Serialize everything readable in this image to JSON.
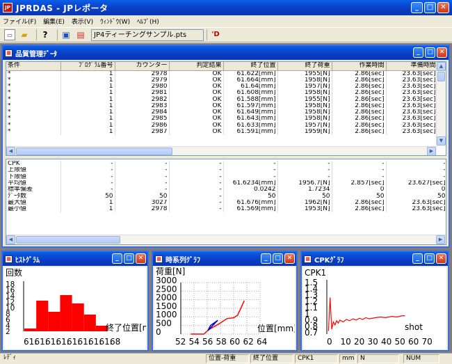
{
  "app": {
    "title": "JPRDAS - JPレポータ",
    "icon_label": "JP"
  },
  "menu": [
    "ファイル(F)",
    "編集(E)",
    "表示(V)",
    "ｳｨﾝﾄﾞｳ(W)",
    "ﾍﾙﾌﾟ(H)"
  ],
  "toolbar": {
    "file_name": "JP4ティーチングサンプル.pts"
  },
  "quality_window": {
    "title": "品質管理ﾃﾞｰﾀ",
    "columns": [
      "条件",
      "ﾌﾟﾛｸﾞﾗﾑ番号",
      "カウンター",
      "判定結果",
      "終了位置",
      "終了荷重",
      "作業時間",
      "準備時間"
    ],
    "rows": [
      [
        "*",
        "1",
        "2978",
        "OK",
        "61.622[mm]",
        "1955[N]",
        "2.86[sec]",
        "23.63[sec]"
      ],
      [
        "*",
        "1",
        "2979",
        "OK",
        "61.664[mm]",
        "1958[N]",
        "2.86[sec]",
        "23.63[sec]"
      ],
      [
        "*",
        "1",
        "2980",
        "OK",
        "61.64[mm]",
        "1957[N]",
        "2.86[sec]",
        "23.63[sec]"
      ],
      [
        "*",
        "1",
        "2981",
        "OK",
        "61.608[mm]",
        "1958[N]",
        "2.86[sec]",
        "23.63[sec]"
      ],
      [
        "*",
        "1",
        "2982",
        "OK",
        "61.588[mm]",
        "1955[N]",
        "2.86[sec]",
        "23.63[sec]"
      ],
      [
        "*",
        "1",
        "2983",
        "OK",
        "61.597[mm]",
        "1958[N]",
        "2.86[sec]",
        "23.63[sec]"
      ],
      [
        "*",
        "1",
        "2984",
        "OK",
        "61.649[mm]",
        "1958[N]",
        "2.86[sec]",
        "23.63[sec]"
      ],
      [
        "*",
        "1",
        "2985",
        "OK",
        "61.643[mm]",
        "1958[N]",
        "2.86[sec]",
        "23.63[sec]"
      ],
      [
        "*",
        "1",
        "2986",
        "OK",
        "61.633[mm]",
        "1957[N]",
        "2.86[sec]",
        "23.63[sec]"
      ],
      [
        "*",
        "1",
        "2987",
        "OK",
        "61.591[mm]",
        "1959[N]",
        "2.86[sec]",
        "23.63[sec]"
      ]
    ],
    "stats_rows": [
      [
        "CPK",
        "-",
        "-",
        "-",
        "-",
        "-",
        "-",
        "-"
      ],
      [
        "上限値",
        "-",
        "-",
        "-",
        "-",
        "-",
        "-",
        "-"
      ],
      [
        "下限値",
        "-",
        "-",
        "-",
        "-",
        "-",
        "-",
        "-"
      ],
      [
        "平均値",
        "-",
        "-",
        "-",
        "61.6234[mm]",
        "1956.7[N]",
        "2.857[sec]",
        "23.627[sec]"
      ],
      [
        "標準偏差",
        "-",
        "-",
        "-",
        "0.0242",
        "1.7234",
        "0",
        "0"
      ],
      [
        "ﾃﾞｰﾀ数",
        "50",
        "50",
        "-",
        "50",
        "50",
        "50",
        "50"
      ],
      [
        "最大値",
        "1",
        "3027",
        "-",
        "61.676[mm]",
        "1962[N]",
        "2.86[sec]",
        "23.63[sec]"
      ],
      [
        "最小値",
        "1",
        "2978",
        "-",
        "61.569[mm]",
        "1953[N]",
        "2.86[sec]",
        "23.63[sec]"
      ]
    ]
  },
  "histogram_window": {
    "title": "ﾋｽﾄｸﾞﾗﾑ"
  },
  "timeseries_window": {
    "title": "時系列ｸﾞﾗﾌ"
  },
  "cpk_window": {
    "title": "CPKｸﾞﾗﾌ"
  },
  "chart_data": [
    {
      "type": "bar",
      "ylabel": "回数",
      "xlabel": "終了位置[m",
      "y_ticks": [
        "18",
        "16",
        "14",
        "12",
        "10",
        "8",
        "6",
        "4",
        "2"
      ],
      "x_ticks": [
        "61.",
        "61.",
        "61.",
        "61.",
        "61.",
        "61.",
        "61.",
        "61.",
        "68"
      ],
      "values": [
        1,
        11,
        7,
        13,
        10,
        6,
        2
      ],
      "ylim": [
        0,
        18
      ],
      "color": "#ff0000"
    },
    {
      "type": "line",
      "ylabel": "荷重[N]",
      "xlabel": "位置[mm]",
      "y_ticks": [
        "3000",
        "2500",
        "2000",
        "1500",
        "1000",
        "500",
        "0"
      ],
      "x_ticks": [
        "52",
        "54",
        "56",
        "58",
        "60",
        "62",
        "64"
      ],
      "xlim": [
        52,
        64
      ],
      "ylim": [
        0,
        3000
      ],
      "grid": true,
      "series": [
        {
          "color": "#ff0000",
          "x": [
            53.5,
            55.5,
            56.2,
            57.8,
            59,
            60,
            60.6,
            61.2,
            61.6
          ],
          "y": [
            0,
            0,
            250,
            600,
            900,
            950,
            1100,
            1600,
            1950
          ]
        },
        {
          "color": "#0000cc",
          "x": [
            56.1,
            57.2,
            57.6,
            56.5,
            56.1
          ],
          "y": [
            200,
            650,
            800,
            500,
            200
          ]
        }
      ]
    },
    {
      "type": "line",
      "ylabel": "CPK1",
      "xlabel": "shot",
      "y_ticks": [
        "1.5",
        "1.4",
        "1.3",
        "1.2",
        "1.1",
        "1",
        "0.9",
        "0.8",
        "0.7"
      ],
      "x_ticks": [
        "0",
        "10",
        "20",
        "30",
        "40",
        "50",
        "60",
        "70"
      ],
      "xlim": [
        0,
        70
      ],
      "ylim": [
        0.7,
        1.5
      ],
      "series": [
        {
          "color": "#ff0000",
          "x": [
            1,
            2,
            3,
            4,
            5,
            6,
            7,
            8,
            10,
            12,
            14,
            16,
            18,
            20,
            22,
            24,
            26,
            28,
            30,
            33,
            36,
            40,
            43,
            46,
            48
          ],
          "y": [
            0.75,
            1.3,
            0.78,
            0.9,
            0.85,
            0.92,
            0.88,
            0.93,
            0.9,
            0.94,
            0.92,
            0.95,
            0.93,
            0.96,
            0.94,
            0.97,
            0.95,
            0.96,
            0.97,
            0.98,
            0.97,
            0.99,
            0.98,
            1.0,
            1.0
          ]
        }
      ]
    }
  ],
  "status": {
    "ready": "ﾚﾃﾞｨ",
    "chart_kind": "位置-荷重",
    "field": "終了位置",
    "cpk": "CPK1",
    "unit": "mm",
    "flag": "N",
    "num": "NUM"
  }
}
